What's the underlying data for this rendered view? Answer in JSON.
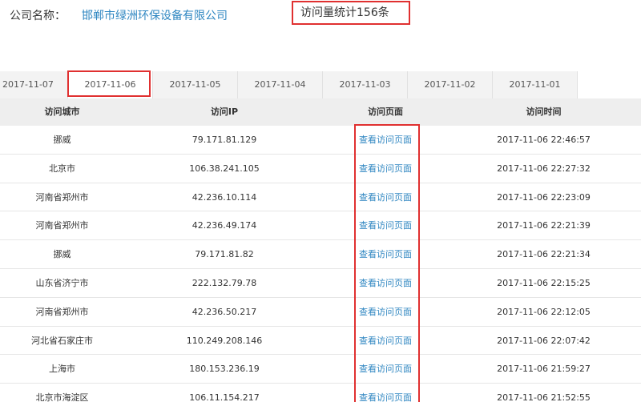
{
  "header": {
    "company_label": "公司名称：",
    "company_name": "邯郸市绿洲环保设备有限公司",
    "visit_count": "访问量统计156条"
  },
  "tabs": [
    {
      "label": "2017-11-07",
      "active": false
    },
    {
      "label": "2017-11-06",
      "active": true
    },
    {
      "label": "2017-11-05",
      "active": false
    },
    {
      "label": "2017-11-04",
      "active": false
    },
    {
      "label": "2017-11-03",
      "active": false
    },
    {
      "label": "2017-11-02",
      "active": false
    },
    {
      "label": "2017-11-01",
      "active": false
    }
  ],
  "table": {
    "headers": {
      "city": "访问城市",
      "ip": "访问IP",
      "page": "访问页面",
      "time": "访问时间"
    },
    "rows": [
      {
        "city": "挪威",
        "ip": "79.171.81.129",
        "page": "查看访问页面",
        "time": "2017-11-06 22:46:57"
      },
      {
        "city": "北京市",
        "ip": "106.38.241.105",
        "page": "查看访问页面",
        "time": "2017-11-06 22:27:32"
      },
      {
        "city": "河南省郑州市",
        "ip": "42.236.10.114",
        "page": "查看访问页面",
        "time": "2017-11-06 22:23:09"
      },
      {
        "city": "河南省郑州市",
        "ip": "42.236.49.174",
        "page": "查看访问页面",
        "time": "2017-11-06 22:21:39"
      },
      {
        "city": "挪威",
        "ip": "79.171.81.82",
        "page": "查看访问页面",
        "time": "2017-11-06 22:21:34"
      },
      {
        "city": "山东省济宁市",
        "ip": "222.132.79.78",
        "page": "查看访问页面",
        "time": "2017-11-06 22:15:25"
      },
      {
        "city": "河南省郑州市",
        "ip": "42.236.50.217",
        "page": "查看访问页面",
        "time": "2017-11-06 22:12:05"
      },
      {
        "city": "河北省石家庄市",
        "ip": "110.249.208.146",
        "page": "查看访问页面",
        "time": "2017-11-06 22:07:42"
      },
      {
        "city": "上海市",
        "ip": "180.153.236.19",
        "page": "查看访问页面",
        "time": "2017-11-06 21:59:27"
      },
      {
        "city": "北京市海淀区",
        "ip": "106.11.154.217",
        "page": "查看访问页面",
        "time": "2017-11-06 21:52:55"
      }
    ]
  },
  "colors": {
    "link": "#2e86c1",
    "highlight": "#e03030",
    "header_bg": "#eeeeee",
    "tab_bg": "#f3f3f3"
  }
}
